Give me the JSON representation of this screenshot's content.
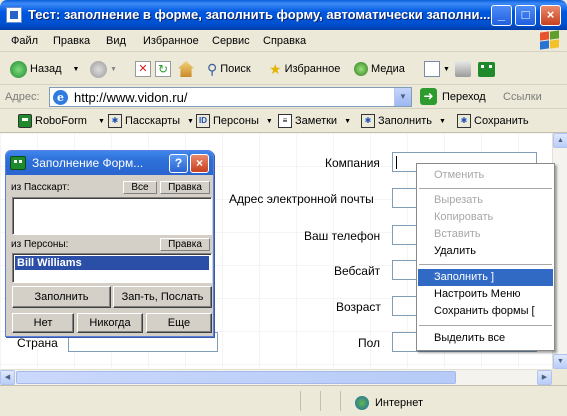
{
  "window": {
    "title": "Тест: заполнение в форме, заполнить форму, автоматически заполни..."
  },
  "menubar": [
    "Файл",
    "Правка",
    "Вид",
    "Избранное",
    "Сервис",
    "Справка"
  ],
  "toolbar": {
    "back": "Назад",
    "search": "Поиск",
    "favorites": "Избранное",
    "media": "Медиа"
  },
  "address": {
    "label": "Адрес:",
    "url": "http://www.vidon.ru/",
    "go": "Переход",
    "links": "Ссылки"
  },
  "roboform_bar": {
    "roboform": "RoboForm",
    "passcards": "Пасскарты",
    "identities": "Персоны",
    "notes": "Заметки",
    "fill": "Заполнить",
    "save": "Сохранить"
  },
  "form": {
    "company": "Компания",
    "email": "Адрес электронной почты",
    "phone": "Ваш телефон",
    "website": "Вебсайт",
    "age": "Возраст",
    "gender": "Пол",
    "country": "Страна"
  },
  "panel": {
    "title": "Заполнение Форм...",
    "passcards_label": "из Пасскарт:",
    "all_btn": "Все",
    "edit_btn": "Правка",
    "identities_label": "из Персоны:",
    "identity_edit_btn": "Правка",
    "selected_identity": "Bill Williams",
    "fill_btn": "Заполнить",
    "fill_send_btn": "Зап-ть, Послать",
    "no_btn": "Нет",
    "never_btn": "Никогда",
    "more_btn": "Еще"
  },
  "context_menu": {
    "undo": "Отменить",
    "cut": "Вырезать",
    "copy": "Копировать",
    "paste": "Вставить",
    "delete": "Удалить",
    "fill": "Заполнить ]",
    "customize": "Настроить Меню",
    "save_forms": "Сохранить формы [",
    "select_all": "Выделить все"
  },
  "status": {
    "zone": "Интернет"
  }
}
